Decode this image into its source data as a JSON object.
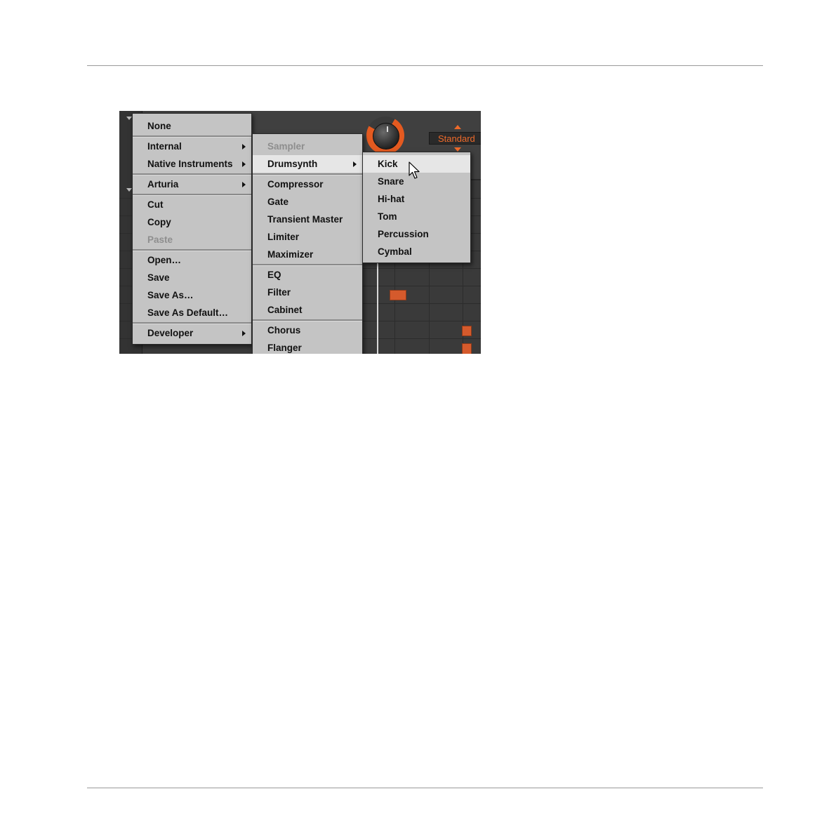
{
  "screenshot": {
    "standard_label": "Standard",
    "colors": {
      "accent": "#e45a20",
      "menu_bg": "#c4c4c4",
      "highlight": "#e6e6e6",
      "note": "#d55a2c"
    }
  },
  "menu_main": {
    "items": [
      {
        "label": "None"
      },
      {
        "label": "Internal",
        "submenu": true
      },
      {
        "label": "Native Instruments",
        "submenu": true
      },
      {
        "label": "Arturia",
        "submenu": true
      },
      {
        "label": "Cut"
      },
      {
        "label": "Copy"
      },
      {
        "label": "Paste",
        "disabled": true
      },
      {
        "label": "Open…"
      },
      {
        "label": "Save"
      },
      {
        "label": "Save As…"
      },
      {
        "label": "Save As Default…"
      },
      {
        "label": "Developer",
        "submenu": true
      }
    ]
  },
  "menu_internal": {
    "items": [
      {
        "label": "Sampler",
        "disabled": true
      },
      {
        "label": "Drumsynth",
        "submenu": true,
        "highlighted": true
      },
      {
        "label": "Compressor"
      },
      {
        "label": "Gate"
      },
      {
        "label": "Transient Master"
      },
      {
        "label": "Limiter"
      },
      {
        "label": "Maximizer"
      },
      {
        "label": "EQ"
      },
      {
        "label": "Filter"
      },
      {
        "label": "Cabinet"
      },
      {
        "label": "Chorus"
      },
      {
        "label": "Flanger"
      }
    ]
  },
  "menu_drumsynth": {
    "items": [
      {
        "label": "Kick",
        "highlighted": true
      },
      {
        "label": "Snare"
      },
      {
        "label": "Hi-hat"
      },
      {
        "label": "Tom"
      },
      {
        "label": "Percussion"
      },
      {
        "label": "Cymbal"
      }
    ]
  }
}
